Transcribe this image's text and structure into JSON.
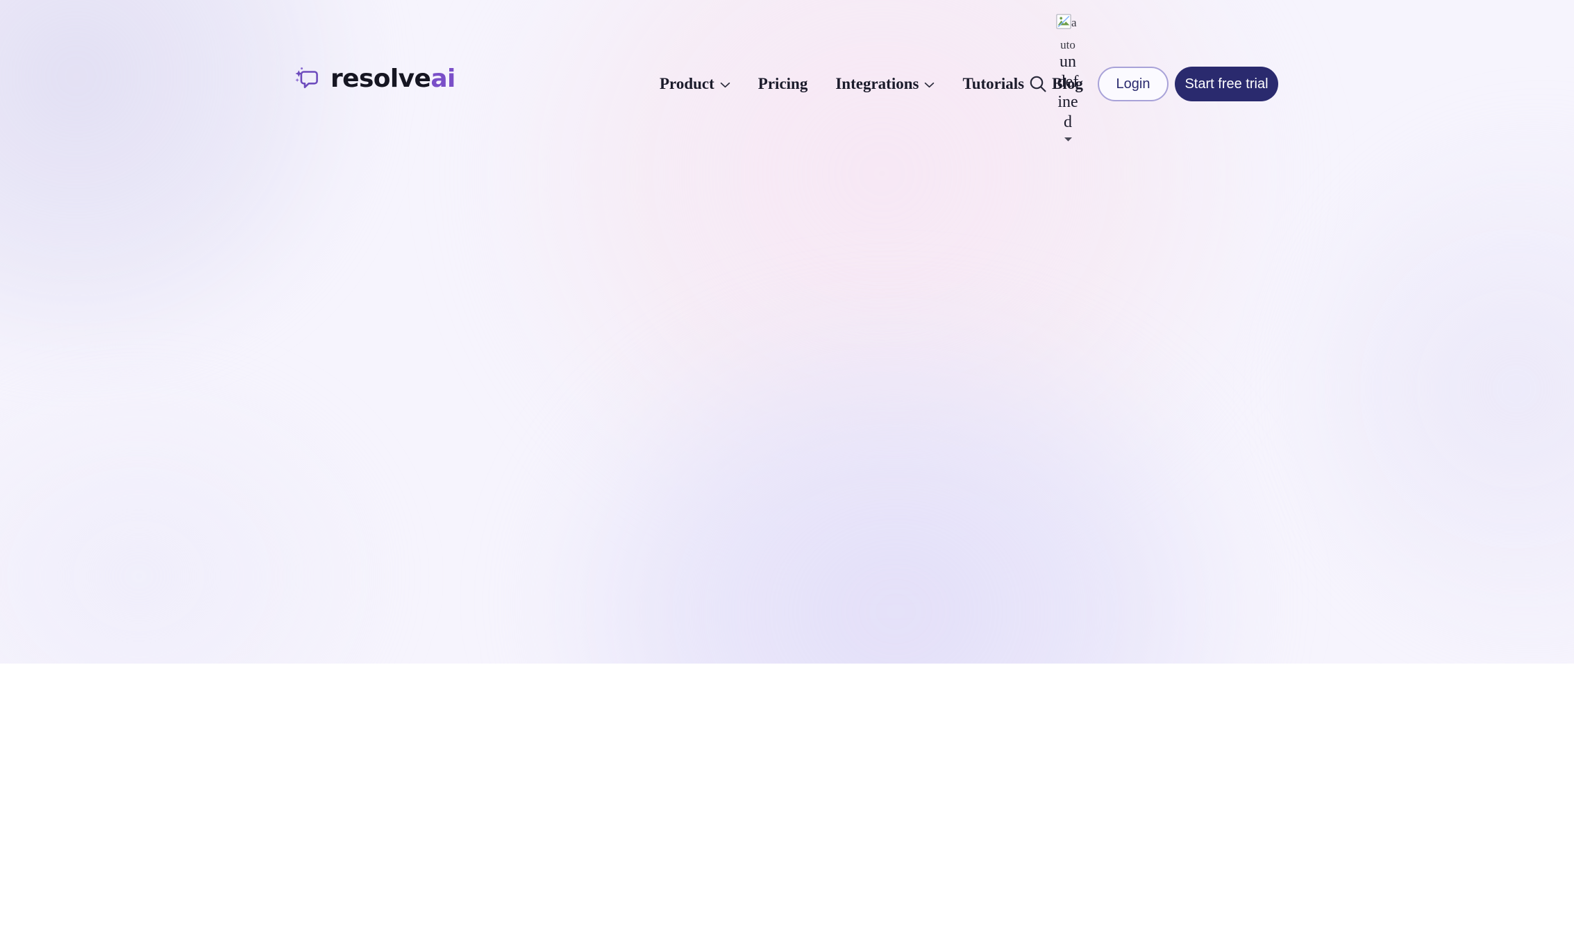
{
  "brand": {
    "logo_icon": "sparkle-chat-bubble-icon",
    "name_primary": "resolve",
    "name_accent": "ai",
    "accent_color": "#7a4fc8",
    "text_color": "#161622"
  },
  "header": {
    "background_color": "#f6f4fd",
    "nav": [
      {
        "label": "Product",
        "has_dropdown": true,
        "icon": "chevron-down-icon"
      },
      {
        "label": "Pricing",
        "has_dropdown": false,
        "icon": ""
      },
      {
        "label": "Integrations",
        "has_dropdown": true,
        "icon": "chevron-down-icon"
      },
      {
        "label": "Tutorials",
        "has_dropdown": false,
        "icon": ""
      },
      {
        "label": "Blog",
        "has_dropdown": false,
        "icon": ""
      }
    ],
    "search": {
      "icon": "search-icon",
      "label": "Search"
    },
    "language_selector": {
      "image_state": "broken-image",
      "alt_text_head": "a",
      "alt_text_rest": "uto",
      "label": "undefined",
      "icon": "chevron-down-icon"
    },
    "actions": {
      "login": {
        "label": "Login",
        "style": "outline",
        "border_color": "#a8a2d8",
        "text_color": "#2a2a6e",
        "background_color": "#fbfaff"
      },
      "trial": {
        "label": "Start free trial",
        "style": "filled",
        "background_color": "#2a2a6e",
        "text_color": "#ffffff"
      }
    }
  },
  "hero": {
    "background_base": "#f6f4fd",
    "gradient_colors": {
      "lavender": "#e1def3",
      "pink": "#f7e6f4",
      "periwinkle": "#e2def8",
      "white": "#ffffff"
    },
    "content": ""
  },
  "below_fold": {
    "background_color": "#ffffff",
    "content": ""
  }
}
